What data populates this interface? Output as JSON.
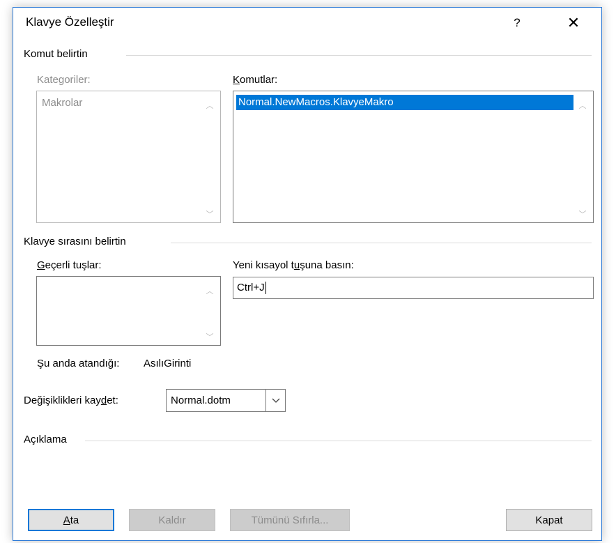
{
  "window": {
    "title": "Klavye Özelleştir",
    "help_glyph": "?",
    "close_glyph": "✕"
  },
  "specify_command": {
    "group_label": "Komut belirtin",
    "categories_label": "Kategoriler:",
    "categories": [
      "Makrolar"
    ],
    "commands_label_pre": "",
    "commands_label_accel": "K",
    "commands_label_post": "omutlar:",
    "commands": [
      "Normal.NewMacros.KlavyeMakro"
    ]
  },
  "specify_keys": {
    "group_label": "Klavye sırasını belirtin",
    "current_keys_label_pre": "",
    "current_keys_label_accel": "G",
    "current_keys_label_post": "eçerli tuşlar:",
    "new_shortcut_label_pre": "Yeni kısayol t",
    "new_shortcut_label_accel": "u",
    "new_shortcut_label_post": "şuna basın:",
    "new_shortcut_value": "Ctrl+J",
    "currently_assigned_label": "Şu anda atandığı:",
    "currently_assigned_value": "AsılıGirinti"
  },
  "save_changes": {
    "label_pre": "Değişiklikleri kay",
    "label_accel": "d",
    "label_post": "et:",
    "selected": "Normal.dotm"
  },
  "description": {
    "group_label": "Açıklama"
  },
  "buttons": {
    "assign_accel": "A",
    "assign_rest": "ta",
    "remove": "Kaldır",
    "reset_all": "Tümünü Sıfırla...",
    "close": "Kapat"
  },
  "colors": {
    "accent": "#0078d7",
    "window_border": "#2b79d6",
    "disabled_text": "#8c8c8c"
  }
}
